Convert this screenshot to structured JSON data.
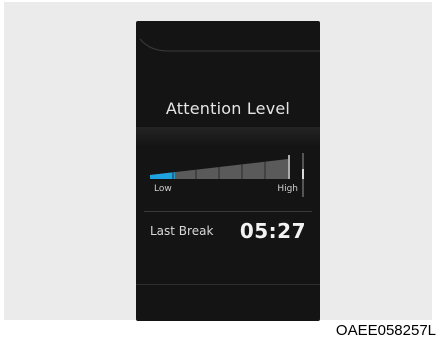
{
  "screen": {
    "title": "Attention Level",
    "gauge": {
      "low_label": "Low",
      "high_label": "High",
      "level_fraction": 0.18,
      "fill_color": "#1fa3e0",
      "track_color": "#5a5a5a"
    },
    "last_break": {
      "label": "Last Break",
      "time": "05:27"
    }
  },
  "figure_code": "OAEE058257L"
}
